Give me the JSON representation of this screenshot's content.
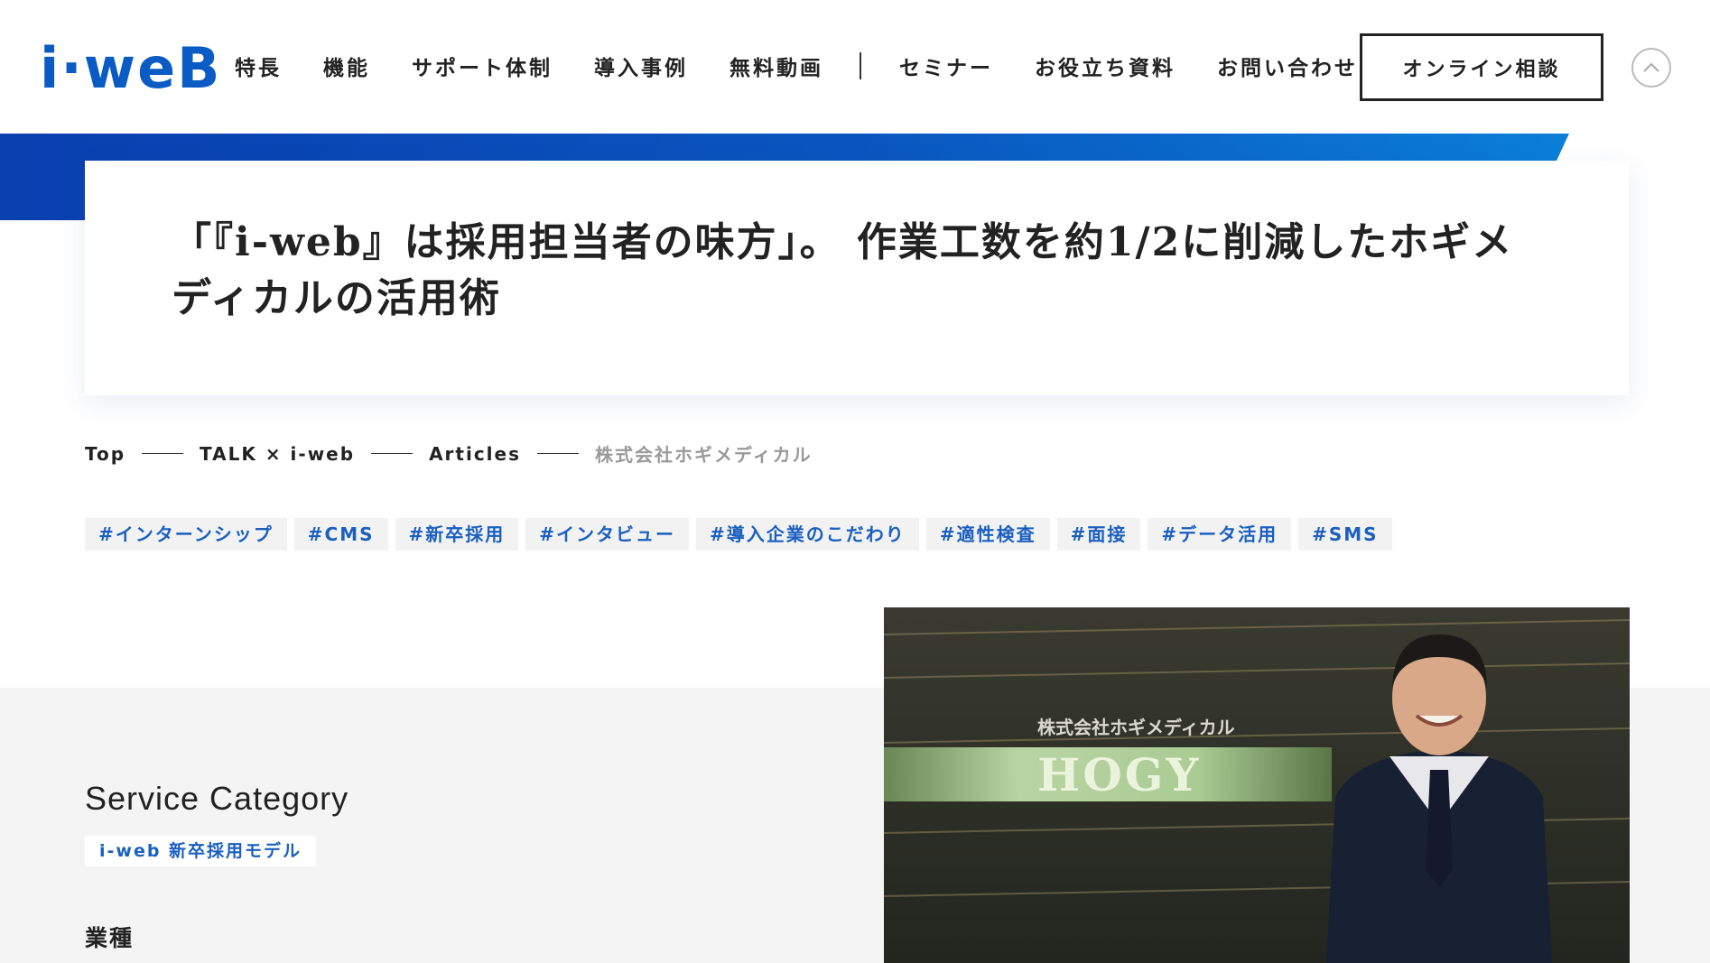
{
  "header": {
    "logo_text": "i·weB",
    "nav": [
      {
        "label": "特長"
      },
      {
        "label": "機能"
      },
      {
        "label": "サポート体制"
      },
      {
        "label": "導入事例"
      },
      {
        "label": "無料動画"
      },
      {
        "label": "セミナー"
      },
      {
        "label": "お役立ち資料"
      },
      {
        "label": "お問い合わせ"
      }
    ],
    "cta_label": "オンライン相談",
    "scroll_top_icon": "chevron-up-icon"
  },
  "article": {
    "title": "「『i-web』は採用担当者の味方」。 作業工数を約1/2に削減したホギメディカルの活用術"
  },
  "breadcrumb": {
    "items": [
      "Top",
      "TALK × i-web",
      "Articles"
    ],
    "current": "株式会社ホギメディカル"
  },
  "tags": [
    "#インターンシップ",
    "#CMS",
    "#新卒採用",
    "#インタビュー",
    "#導入企業のこだわり",
    "#適性検査",
    "#面接",
    "#データ活用",
    "#SMS"
  ],
  "service": {
    "heading": "Service Category",
    "category": "i-web 新卒採用モデル",
    "industry_label": "業種"
  },
  "photo": {
    "sign_small": "株式会社ホギメディカル",
    "sign_large": "HOGY"
  },
  "colors": {
    "brand_blue": "#0b5bc4",
    "tag_blue": "#1a5fc0",
    "gray_bg": "#f4f4f4"
  }
}
